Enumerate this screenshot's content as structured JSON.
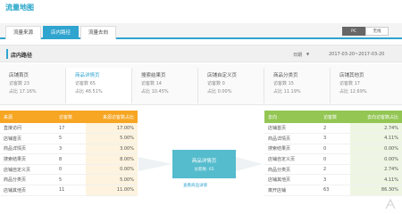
{
  "page": {
    "title": "流量地图"
  },
  "tabs": [
    {
      "label": "流量来源"
    },
    {
      "label": "店内路径"
    },
    {
      "label": "流量去向"
    }
  ],
  "device_toggle": {
    "pc": "PC",
    "wireless": "无线"
  },
  "section": {
    "title": "店内路径",
    "date_label": "日期",
    "date_range": "2017-03-20~2017-03-20"
  },
  "stats": [
    {
      "name": "店铺首页",
      "visits": "访客数 23",
      "share": "占比 17.16%"
    },
    {
      "name": "商品详情页",
      "visits": "访客数 65",
      "share": "占比 48.51%"
    },
    {
      "name": "搜索结果页",
      "visits": "访客数 14",
      "share": "占比 10.45%"
    },
    {
      "name": "店铺自定义页",
      "visits": "访客数 0",
      "share": "占比 0.00%"
    },
    {
      "name": "商品分类页",
      "visits": "访客数 15",
      "share": "占比 11.19%"
    },
    {
      "name": "店铺其他页",
      "visits": "访客数 17",
      "share": "占比 12.69%"
    }
  ],
  "source_table": {
    "headers": [
      "来源",
      "访客数",
      "来源访客数占比"
    ],
    "rows": [
      [
        "直接访问",
        "17",
        "17.00%"
      ],
      [
        "店铺首页",
        "5",
        "5.00%"
      ],
      [
        "商品详情页",
        "3",
        "3.00%"
      ],
      [
        "搜索结果页",
        "8",
        "8.00%"
      ],
      [
        "店铺自定义页",
        "0",
        "0.00%"
      ],
      [
        "商品分类页",
        "5",
        "5.00%"
      ],
      [
        "店铺其他页",
        "11",
        "11.00%"
      ]
    ]
  },
  "center": {
    "title": "商品详情页",
    "visits": "访客数: 65",
    "link": "查看商品详情"
  },
  "dest_table": {
    "headers": [
      "去向",
      "访客数",
      "去向访客数占比"
    ],
    "rows": [
      [
        "店铺首页",
        "2",
        "2.74%"
      ],
      [
        "商品详情页",
        "3",
        "4.11%"
      ],
      [
        "搜索结果页",
        "0",
        "0.00%"
      ],
      [
        "店铺自定义页",
        "0",
        "0.00%"
      ],
      [
        "商品分类页",
        "2",
        "2.74%"
      ],
      [
        "店铺其他页",
        "3",
        "4.11%"
      ],
      [
        "离开店铺",
        "63",
        "86.30%"
      ]
    ]
  }
}
